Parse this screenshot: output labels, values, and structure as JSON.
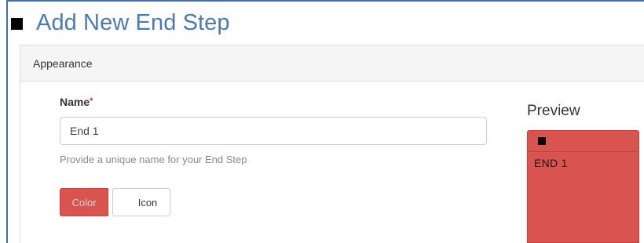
{
  "page": {
    "title": "Add New End Step",
    "title_icon": "square-icon"
  },
  "panel": {
    "heading": "Appearance"
  },
  "name_field": {
    "label": "Name",
    "required_mark": "*",
    "value": "End 1",
    "help_text": "Provide a unique name for your End Step"
  },
  "tabs": {
    "color_label": "Color",
    "icon_label": "Icon",
    "active": "Color"
  },
  "preview": {
    "label": "Preview",
    "icon": "square-icon",
    "text": "END 1"
  },
  "colors": {
    "accent": "#d9534f",
    "title": "#4a7ab8",
    "frame": "#3f6fb3"
  }
}
